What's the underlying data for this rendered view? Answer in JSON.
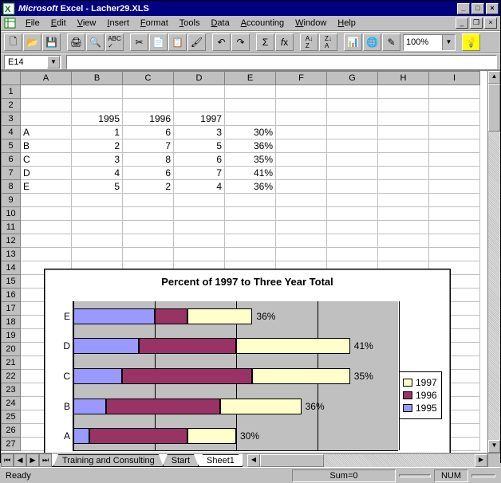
{
  "window": {
    "app_name": "Microsoft",
    "app_name2": "Excel",
    "doc_name": "Lacher29.XLS"
  },
  "menus": [
    "File",
    "Edit",
    "View",
    "Insert",
    "Format",
    "Tools",
    "Data",
    "Accounting",
    "Window",
    "Help"
  ],
  "toolbar_zoom": "100%",
  "namebox": "E14",
  "columns": [
    "A",
    "B",
    "C",
    "D",
    "E",
    "F",
    "G",
    "H",
    "I"
  ],
  "rows": 27,
  "cells": {
    "B3": "1995",
    "C3": "1996",
    "D3": "1997",
    "A4": "A",
    "B4": "1",
    "C4": "6",
    "D4": "3",
    "E4": "30%",
    "A5": "B",
    "B5": "2",
    "C5": "7",
    "D5": "5",
    "E5": "36%",
    "A6": "C",
    "B6": "3",
    "C6": "8",
    "D6": "6",
    "E6": "35%",
    "A7": "D",
    "B7": "4",
    "C7": "6",
    "D7": "7",
    "E7": "41%",
    "A8": "E",
    "B8": "5",
    "C8": "2",
    "D8": "4",
    "E8": "36%"
  },
  "chart_data": {
    "type": "bar",
    "title": "Percent of 1997 to Three Year Total",
    "categories": [
      "A",
      "B",
      "C",
      "D",
      "E"
    ],
    "series": [
      {
        "name": "1995",
        "values": [
          1,
          2,
          3,
          4,
          5
        ],
        "color": "#9999ff"
      },
      {
        "name": "1996",
        "values": [
          6,
          7,
          8,
          6,
          2
        ],
        "color": "#993366"
      },
      {
        "name": "1997",
        "values": [
          3,
          5,
          6,
          7,
          4
        ],
        "color": "#ffffcc"
      }
    ],
    "data_labels": [
      "30%",
      "36%",
      "35%",
      "41%",
      "36%"
    ],
    "xlim": [
      0,
      20
    ],
    "xticks": [
      0,
      5,
      10,
      15,
      20
    ],
    "legend_order": [
      "1997",
      "1996",
      "1995"
    ]
  },
  "tabs": [
    "Training and Consulting",
    "Start",
    "Sheet1"
  ],
  "active_tab": 2,
  "status": {
    "ready": "Ready",
    "sum": "Sum=0",
    "num": "NUM"
  }
}
